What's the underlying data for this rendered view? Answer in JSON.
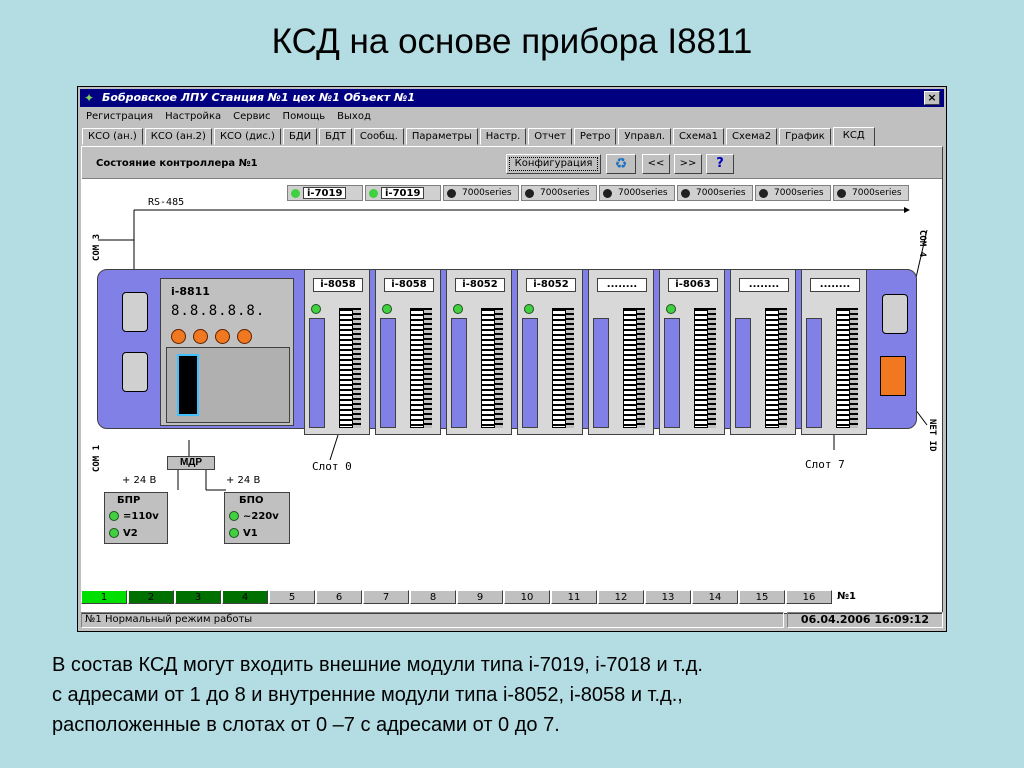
{
  "slide": {
    "title": "КСД на основе прибора I8811",
    "caption_lines": [
      "В состав  КСД могут входить внешние модули  типа i-7019, i-7018 и т.д.",
      "с адресами от 1 до 8  и внутренние модули типа i-8052, i-8058 и т.д.,",
      "расположенные в слотах  от 0 –7 с адресами от 0 до 7."
    ]
  },
  "window": {
    "title": "Бобровское  ЛПУ Станция №1  цех №1  Объект №1",
    "close_label": "×"
  },
  "menu": [
    "Регистрация",
    "Настройка",
    "Сервис",
    "Помощь",
    "Выход"
  ],
  "tabs": [
    "КСО (ан.)",
    "КСО (ан.2)",
    "КСО (дис.)",
    "БДИ",
    "БДТ",
    "Сообщ.",
    "Параметры",
    "Настр.",
    "Отчет",
    "Ретро",
    "Управл.",
    "Схема1",
    "Схема2",
    "График",
    "КСД"
  ],
  "active_tab": "КСД",
  "panel": {
    "title": "Состояние контроллера №1",
    "config_button": "Конфигурация",
    "prev_button": "<<",
    "next_button": ">>",
    "help_button": "?"
  },
  "diagram": {
    "bus_label": "RS-485",
    "ext_modules": [
      {
        "name": "i-7019",
        "status": "on"
      },
      {
        "name": "i-7019",
        "status": "on"
      },
      {
        "name": "7000series",
        "status": "off"
      },
      {
        "name": "7000series",
        "status": "off"
      },
      {
        "name": "7000series",
        "status": "off"
      },
      {
        "name": "7000series",
        "status": "off"
      },
      {
        "name": "7000series",
        "status": "off"
      },
      {
        "name": "7000series",
        "status": "off"
      }
    ],
    "com3": "COM 3",
    "com1": "COM 1",
    "com4": "COM 4",
    "net_id": "NET ID",
    "cpu_name": "i-8811",
    "cpu_digits": "8.8.8.8.8.",
    "slots": [
      "i-8058",
      "i-8058",
      "i-8052",
      "i-8052",
      "",
      "i-8063",
      "",
      ""
    ],
    "slot0_label": "Слот 0",
    "slot7_label": "Слот 7",
    "mdr_label": "МДР",
    "volt_left": "+ 24 В",
    "volt_right": "+ 24 В",
    "bpr": {
      "title": "БПР",
      "line1": "=110v",
      "line2": "V2"
    },
    "bpo": {
      "title": "БПО",
      "line1": "~220v",
      "line2": "V1"
    }
  },
  "address_bar": {
    "cells": [
      "1",
      "2",
      "3",
      "4",
      "5",
      "6",
      "7",
      "8",
      "9",
      "10",
      "11",
      "12",
      "13",
      "14",
      "15",
      "16"
    ],
    "extra": "№1"
  },
  "status": {
    "message": "№1 Нормальный режим работы",
    "datetime": "06.04.2006 16:09:12"
  },
  "colors": {
    "desktop_bg": "#b3dce3",
    "titlebar": "#000080",
    "chassis": "#8080e6",
    "led_on": "#40d040",
    "led_off": "#202020"
  }
}
